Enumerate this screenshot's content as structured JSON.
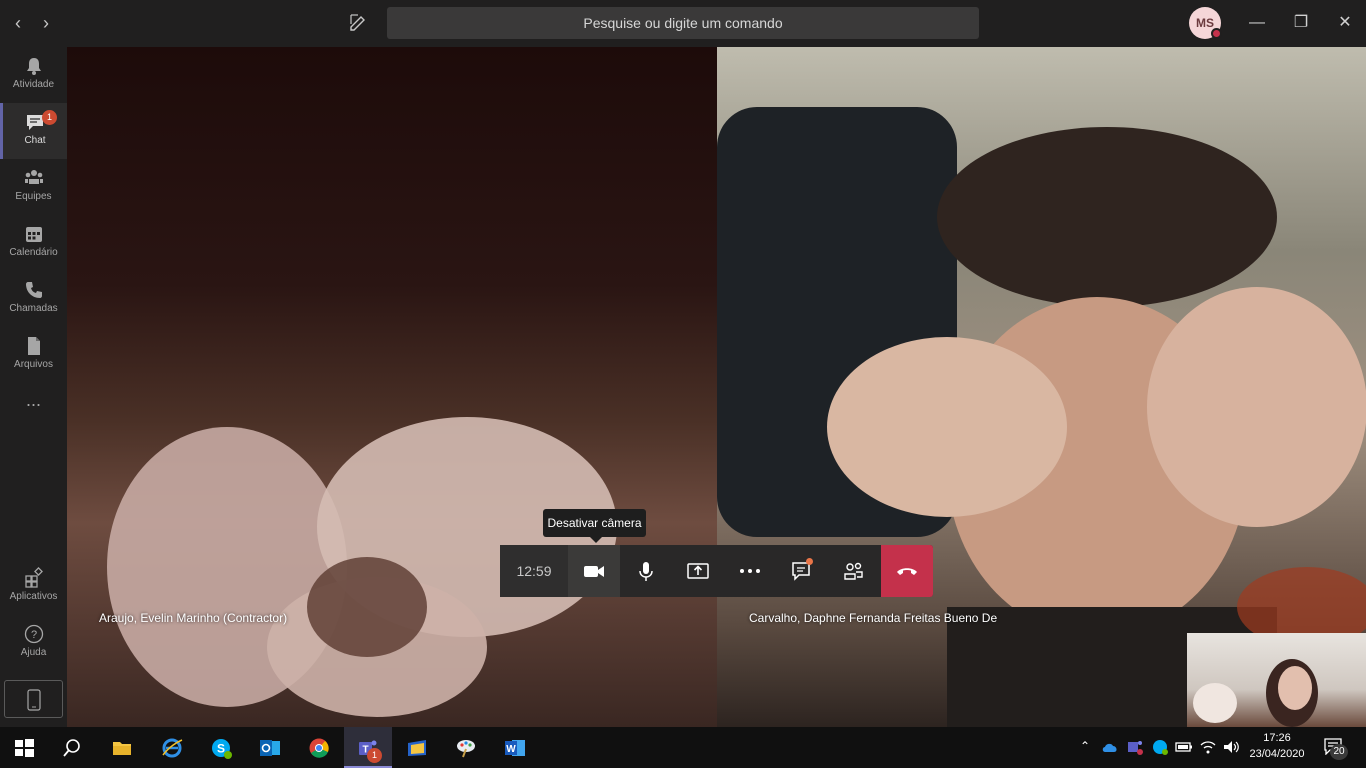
{
  "titlebar": {
    "search_placeholder": "Pesquise ou digite um comando",
    "avatar_initials": "MS",
    "presence_color": "#c4314b"
  },
  "rail": {
    "items": [
      {
        "label": "Atividade",
        "icon": "bell-icon"
      },
      {
        "label": "Chat",
        "icon": "chat-icon",
        "badge": "1",
        "active": true
      },
      {
        "label": "Equipes",
        "icon": "teams-icon"
      },
      {
        "label": "Calendário",
        "icon": "calendar-icon"
      },
      {
        "label": "Chamadas",
        "icon": "phone-icon"
      },
      {
        "label": "Arquivos",
        "icon": "file-icon"
      }
    ],
    "more": "...",
    "apps_label": "Aplicativos",
    "help_label": "Ajuda"
  },
  "call": {
    "participants": [
      {
        "name": "Araujo, Evelin Marinho (Contractor)"
      },
      {
        "name": "Carvalho, Daphne Fernanda Freitas Bueno De"
      }
    ],
    "timer": "12:59",
    "tooltip": "Desativar câmera",
    "hangup_color": "#c4314b"
  },
  "taskbar": {
    "time": "17:26",
    "date": "23/04/2020",
    "notifications": "20",
    "teams_badge": "1",
    "apps": [
      "file-explorer-icon",
      "internet-explorer-icon",
      "skype-icon",
      "outlook-icon",
      "chrome-icon",
      "teams-icon",
      "folder-app-icon",
      "paint-icon",
      "word-icon"
    ]
  },
  "accent": "#6264a7"
}
